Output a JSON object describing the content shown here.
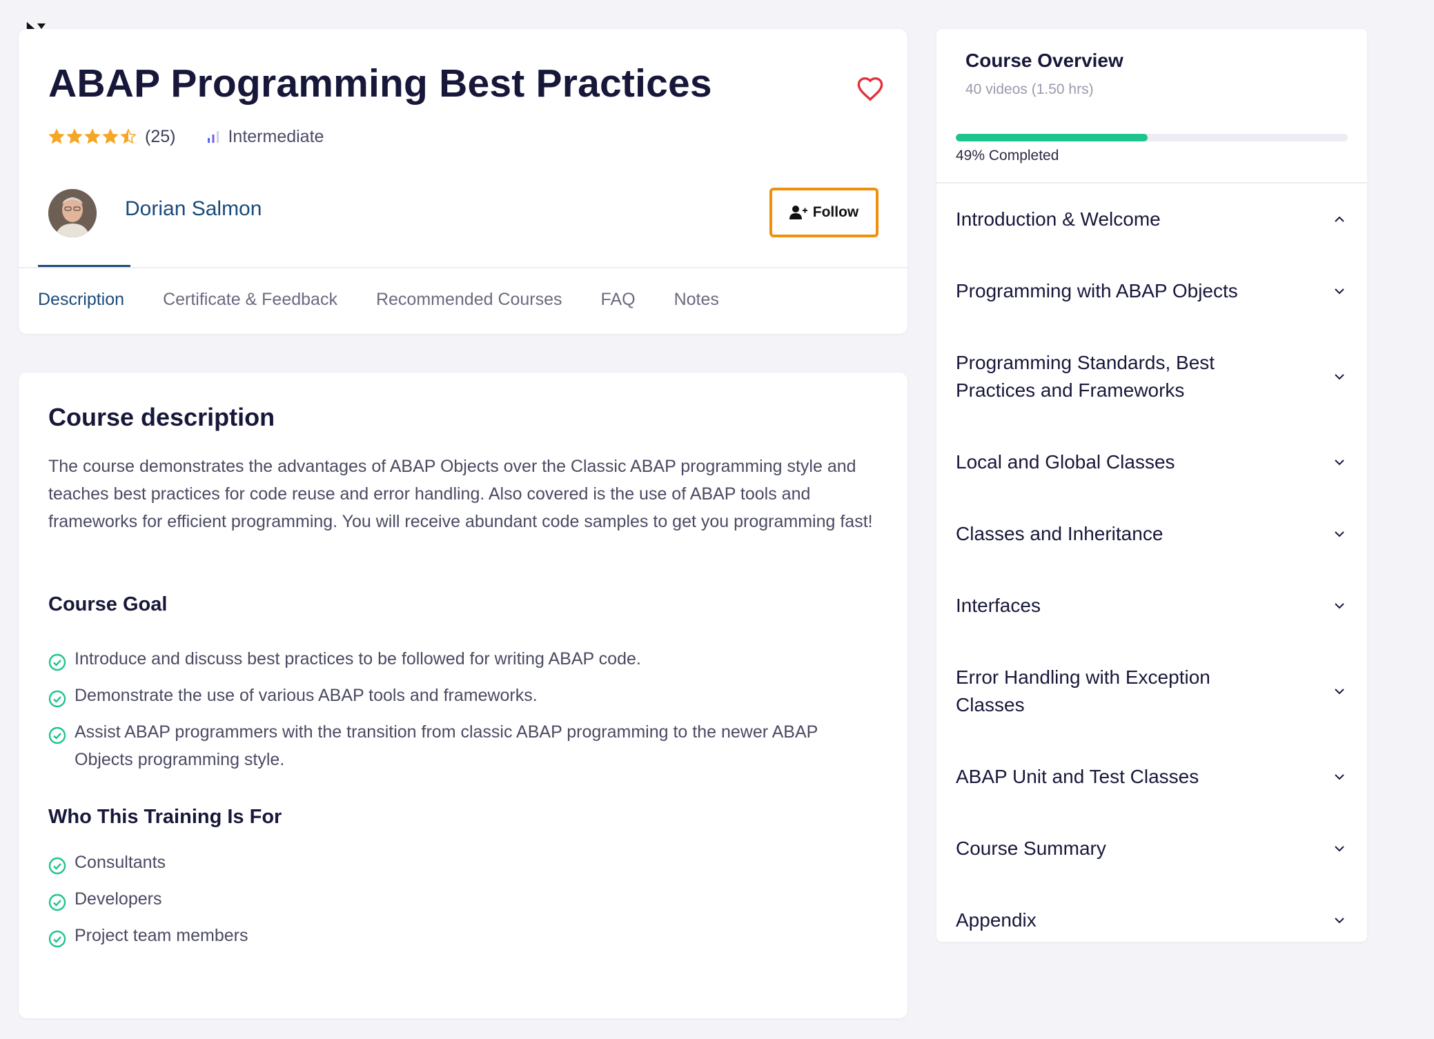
{
  "course": {
    "title": "ABAP Programming Best Practices",
    "rating": 4.5,
    "rating_count": "(25)",
    "level": "Intermediate",
    "author": "Dorian Salmon",
    "follow_label": "Follow"
  },
  "tabs": [
    {
      "label": "Description",
      "active": true
    },
    {
      "label": "Certificate & Feedback",
      "active": false
    },
    {
      "label": "Recommended Courses",
      "active": false
    },
    {
      "label": "FAQ",
      "active": false
    },
    {
      "label": "Notes",
      "active": false
    }
  ],
  "description": {
    "heading": "Course description",
    "body": "The course demonstrates the advantages of ABAP Objects over the Classic ABAP programming style and teaches best practices for code reuse and error handling. Also covered is the use of ABAP tools and frameworks for efficient programming. You will receive abundant code samples to get you programming fast!",
    "goal_heading": "Course Goal",
    "goals": [
      "Introduce and discuss best practices to be followed for writing ABAP code.",
      "Demonstrate the use of various ABAP tools and frameworks.",
      "Assist ABAP programmers with the transition from classic ABAP programming to the newer ABAP Objects programming style."
    ],
    "audience_heading": "Who This Training Is For",
    "audience": [
      "Consultants",
      "Developers",
      "Project team members"
    ]
  },
  "overview": {
    "title": "Course Overview",
    "subtitle": "40 videos (1.50 hrs)",
    "progress_percent": 49,
    "progress_label": "49% Completed",
    "sections": [
      {
        "label": "Introduction & Welcome",
        "expanded": true
      },
      {
        "label": "Programming with ABAP Objects",
        "expanded": false
      },
      {
        "label": "Programming Standards, Best Practices and Frameworks",
        "expanded": false
      },
      {
        "label": "Local and Global Classes",
        "expanded": false
      },
      {
        "label": "Classes and Inheritance",
        "expanded": false
      },
      {
        "label": "Interfaces",
        "expanded": false
      },
      {
        "label": "Error Handling with Exception Classes",
        "expanded": false
      },
      {
        "label": "ABAP Unit and Test Classes",
        "expanded": false
      },
      {
        "label": "Course Summary",
        "expanded": false
      },
      {
        "label": "Appendix",
        "expanded": false
      }
    ]
  },
  "colors": {
    "accent": "#1a4a7a",
    "progress": "#1ec48e",
    "follow_border": "#f0900a",
    "heart": "#e0303a",
    "star": "#f5a623",
    "check": "#1ec48e"
  },
  "icons": {
    "favorite": "heart-icon",
    "level": "bar-chart-icon",
    "follow": "user-plus-icon",
    "check": "check-circle-icon",
    "expand": "chevron-down-icon",
    "collapse": "chevron-up-icon"
  }
}
